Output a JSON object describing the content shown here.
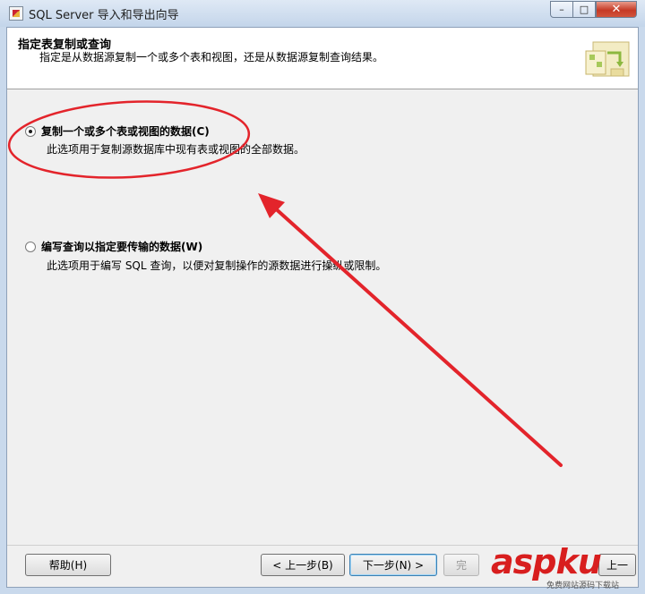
{
  "window": {
    "title": "SQL Server 导入和导出向导",
    "min_label": "–",
    "max_label": "□",
    "close_label": "✕"
  },
  "header": {
    "title": "指定表复制或查询",
    "subtitle": "指定是从数据源复制一个或多个表和视图，还是从数据源复制查询结果。"
  },
  "options": [
    {
      "label": "复制一个或多个表或视图的数据(C)",
      "description": "此选项用于复制源数据库中现有表或视图的全部数据。",
      "checked": true
    },
    {
      "label": "编写查询以指定要传输的数据(W)",
      "description": "此选项用于编写 SQL 查询，以便对复制操作的源数据进行操纵或限制。",
      "checked": false
    }
  ],
  "buttons": {
    "help": "帮助(H)",
    "back": "< 上一步(B)",
    "next": "下一步(N) >",
    "finish": "完",
    "cancel": "上一"
  },
  "watermark": {
    "brand": "aspku",
    "tagline": "免费网站源码下载站"
  },
  "colors": {
    "annotation": "#e3242b",
    "close_button": "#c63a26",
    "watermark": "#d81e1e"
  }
}
